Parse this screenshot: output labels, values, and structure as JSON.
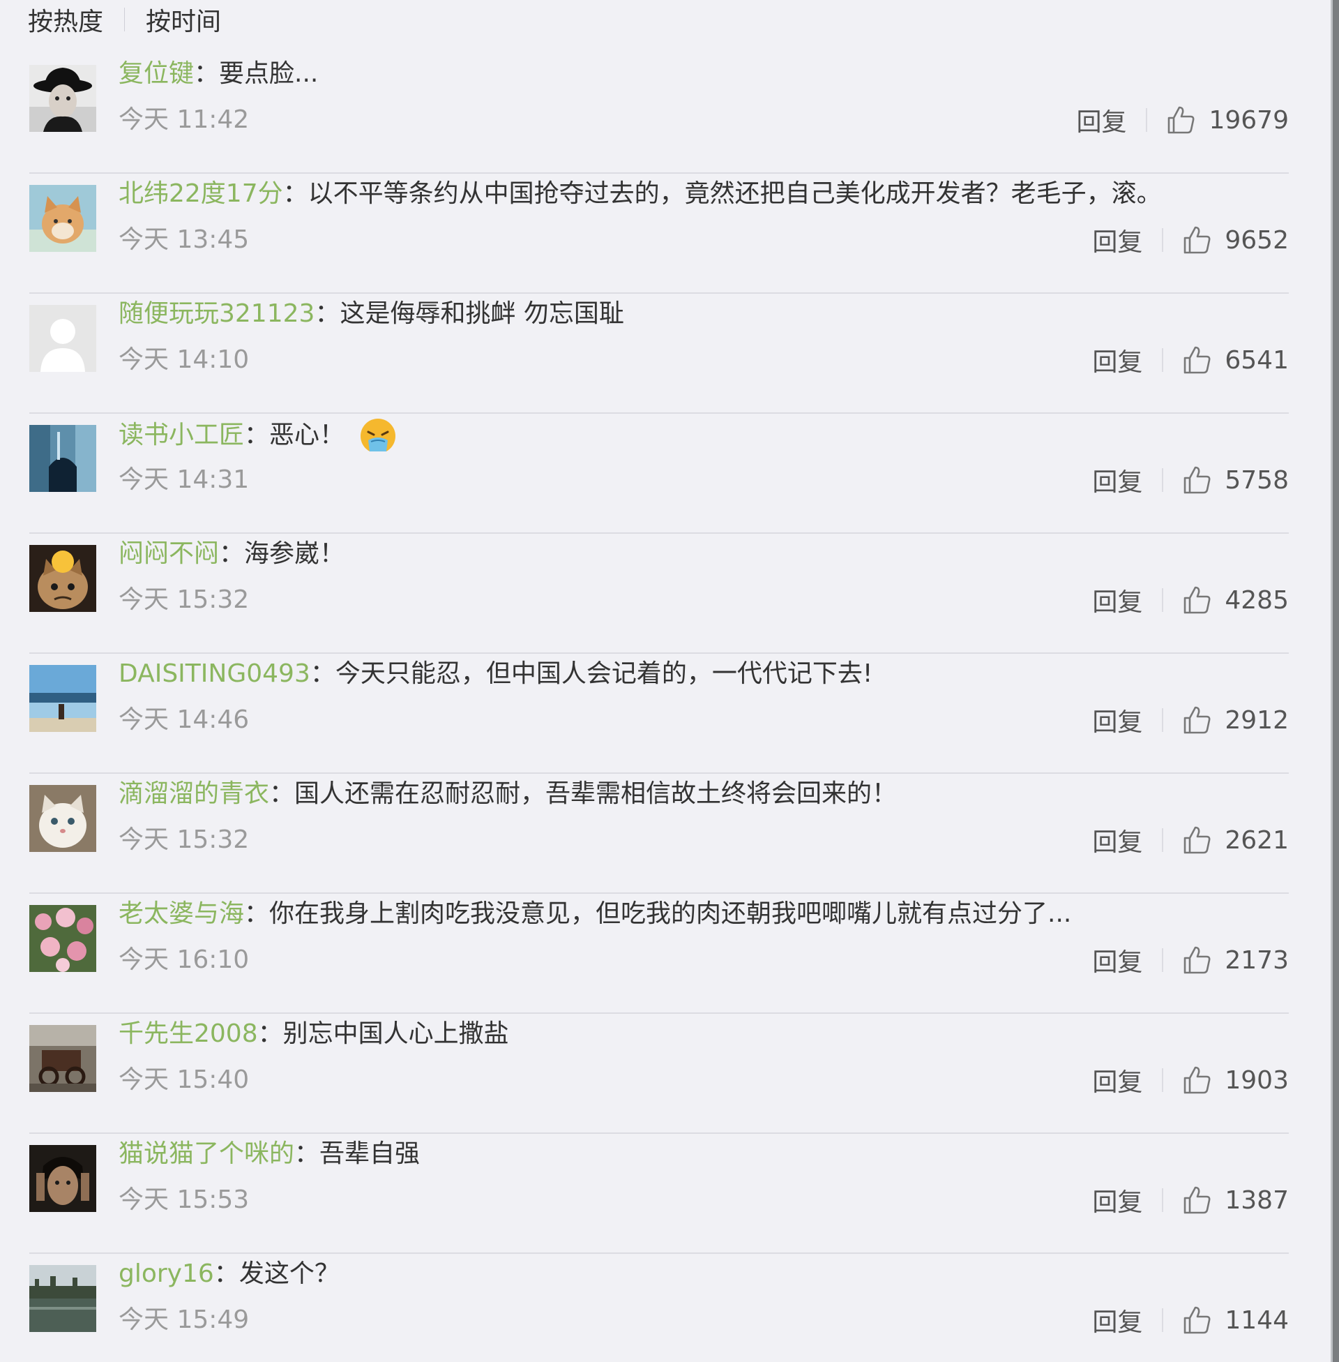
{
  "sort_tabs": {
    "hot_label": "按热度",
    "time_label": "按时间"
  },
  "comments": [
    {
      "username": "复位键",
      "text": "要点脸...",
      "time": "今天 11:42",
      "reply_label": "回复",
      "likes": "19679",
      "avatar_icon": "avatar-man-hat"
    },
    {
      "username": "北纬22度17分",
      "text": "以不平等条约从中国抢夺过去的，竟然还把自己美化成开发者？老毛子，滚。",
      "time": "今天 13:45",
      "reply_label": "回复",
      "likes": "9652",
      "avatar_icon": "avatar-cat-orange"
    },
    {
      "username": "随便玩玩321123",
      "text": "这是侮辱和挑衅 勿忘国耻",
      "time": "今天 14:10",
      "reply_label": "回复",
      "likes": "6541",
      "avatar_icon": "avatar-default"
    },
    {
      "username": "读书小工匠",
      "text": "恶心！",
      "time": "今天 14:31",
      "reply_label": "回复",
      "likes": "5758",
      "avatar_icon": "avatar-tunnel",
      "emoji_icon": "vomit-emoji-icon"
    },
    {
      "username": "闷闷不闷",
      "text": "海参崴！",
      "time": "今天 15:32",
      "reply_label": "回复",
      "likes": "4285",
      "avatar_icon": "avatar-grumpy-cat"
    },
    {
      "username": "DAISITING0493",
      "text": "今天只能忍，但中国人会记着的，一代代记下去!",
      "time": "今天 14:46",
      "reply_label": "回复",
      "likes": "2912",
      "avatar_icon": "avatar-beach"
    },
    {
      "username": "滴溜溜的青衣",
      "text": "国人还需在忍耐忍耐，吾辈需相信故土终将会回来的！",
      "time": "今天 15:32",
      "reply_label": "回复",
      "likes": "2621",
      "avatar_icon": "avatar-white-cat"
    },
    {
      "username": "老太婆与海",
      "text": "你在我身上割肉吃我没意见，但吃我的肉还朝我吧唧嘴儿就有点过分了...",
      "time": "今天 16:10",
      "reply_label": "回复",
      "likes": "2173",
      "avatar_icon": "avatar-flowers"
    },
    {
      "username": "千先生2008",
      "text": "别忘中国人心上撒盐",
      "time": "今天 15:40",
      "reply_label": "回复",
      "likes": "1903",
      "avatar_icon": "avatar-cart"
    },
    {
      "username": "猫说猫了个咪的",
      "text": "吾辈自强",
      "time": "今天 15:53",
      "reply_label": "回复",
      "likes": "1387",
      "avatar_icon": "avatar-face-dark"
    },
    {
      "username": "glory16",
      "text": "发这个？",
      "time": "今天 15:49",
      "reply_label": "回复",
      "likes": "1144",
      "avatar_icon": "avatar-river"
    }
  ],
  "colors": {
    "username": "#8bb65f",
    "text": "#333333",
    "time": "#9a9a9a",
    "background": "#f1f1f5"
  }
}
